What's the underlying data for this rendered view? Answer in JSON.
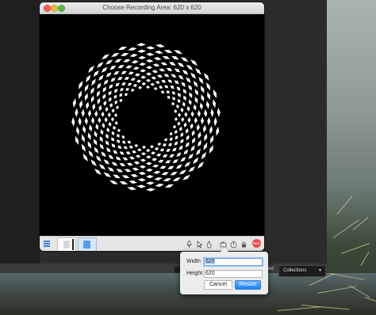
{
  "window": {
    "title": "Choose Recording Area: 620 x 620"
  },
  "canvas": {
    "pattern": "checkered-ring",
    "background": "#000000",
    "foreground": "#ffffff"
  },
  "toolbar": {
    "icons": [
      "microphone-icon",
      "cursor-icon",
      "click-icon",
      "camera-icon",
      "timer-icon",
      "lock-icon"
    ],
    "record_label": "REC"
  },
  "statusbar": {
    "partial_label": "ed",
    "collections_label": "Collections"
  },
  "resize_popover": {
    "width_label": "Width",
    "width_value": "620",
    "height_label": "Height",
    "height_value": "620",
    "cancel_label": "Cancel",
    "resize_label": "Resize"
  },
  "colors": {
    "accent": "#1d7ff5",
    "record": "#ee4a45"
  }
}
